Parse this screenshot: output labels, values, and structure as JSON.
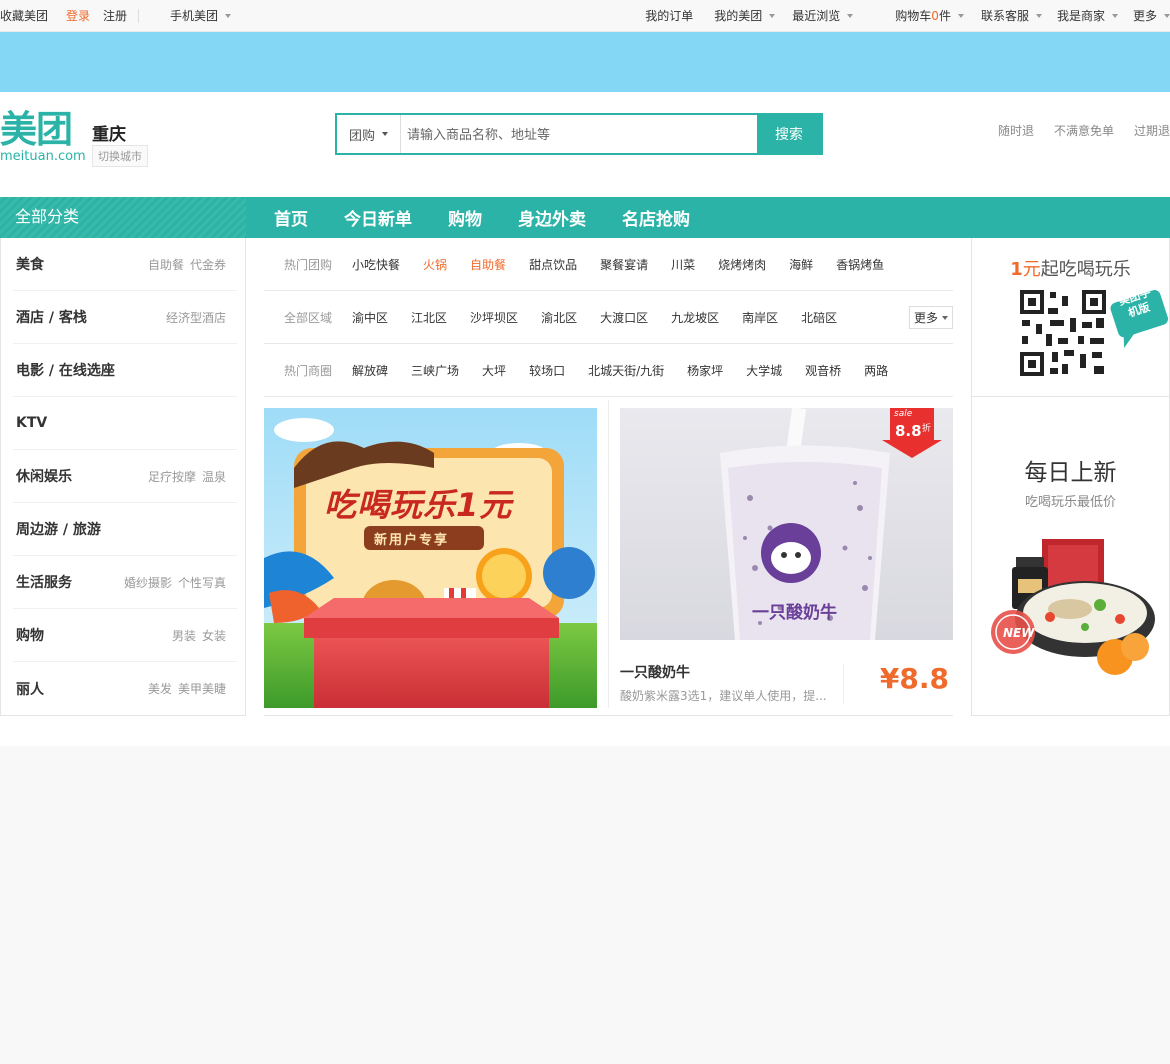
{
  "topbar": {
    "favorite": "收藏美团",
    "login": "登录",
    "register": "注册",
    "mobile": "手机美团",
    "orders": "我的订单",
    "my_meituan": "我的美团",
    "recent": "最近浏览",
    "cart_prefix": "购物车",
    "cart_count": "0",
    "cart_suffix": "件",
    "service": "联系客服",
    "merchant": "我是商家",
    "more": "更多"
  },
  "header": {
    "logo_cn": "美团",
    "logo_en": "meituan.com",
    "city": "重庆",
    "switch_city": "切换城市",
    "search_category": "团购",
    "search_placeholder": "请输入商品名称、地址等",
    "search_button": "搜索",
    "promises": [
      "随时退",
      "不满意免单",
      "过期退"
    ]
  },
  "nav": {
    "all_categories": "全部分类",
    "links": [
      "首页",
      "今日新单",
      "购物",
      "身边外卖",
      "名店抢购"
    ]
  },
  "categories": [
    {
      "name": "美食",
      "subs": [
        "自助餐",
        "代金券"
      ]
    },
    {
      "name": "酒店 / 客栈",
      "subs": [
        "经济型酒店"
      ]
    },
    {
      "name": "电影 / 在线选座",
      "subs": []
    },
    {
      "name": "KTV",
      "subs": []
    },
    {
      "name": "休闲娱乐",
      "subs": [
        "足疗按摩",
        "温泉"
      ]
    },
    {
      "name": "周边游 / 旅游",
      "subs": []
    },
    {
      "name": "生活服务",
      "subs": [
        "婚纱摄影",
        "个性写真"
      ]
    },
    {
      "name": "购物",
      "subs": [
        "男装",
        "女装"
      ]
    },
    {
      "name": "丽人",
      "subs": [
        "美发",
        "美甲美睫"
      ]
    }
  ],
  "filters": {
    "hot_groups_label": "热门团购",
    "hot_groups": [
      "小吃快餐",
      "火锅",
      "自助餐",
      "甜点饮品",
      "聚餐宴请",
      "川菜",
      "烧烤烤肉",
      "海鲜",
      "香锅烤鱼"
    ],
    "areas_label": "全部区域",
    "areas": [
      "渝中区",
      "江北区",
      "沙坪坝区",
      "渝北区",
      "大渡口区",
      "九龙坡区",
      "南岸区",
      "北碚区"
    ],
    "areas_more": "更多",
    "districts_label": "热门商圈",
    "districts": [
      "解放碑",
      "三峡广场",
      "大坪",
      "较场口",
      "北城天街/九街",
      "杨家坪",
      "大学城",
      "观音桥",
      "两路"
    ]
  },
  "promo": {
    "headline": "吃喝玩乐1元",
    "ribbon": "新用户专享"
  },
  "deal": {
    "title": "一只酸奶牛",
    "desc": "酸奶紫米露3选1，建议单人使用，提...",
    "price": "¥8.8",
    "badge_sale": "sale",
    "badge_value": "8.8",
    "badge_unit": "折",
    "cup_text": "一只酸奶牛"
  },
  "side": {
    "promo_num": "1",
    "promo_unit": "元",
    "promo_rest": "起吃喝玩乐",
    "app_badge": "美团手机版",
    "daily_title": "每日上新",
    "daily_sub": "吃喝玩乐最低价",
    "new_badge": "NEW"
  },
  "colors": {
    "brand": "#2ab3a6",
    "accent": "#f06a2c",
    "banner": "#84d8f5"
  }
}
